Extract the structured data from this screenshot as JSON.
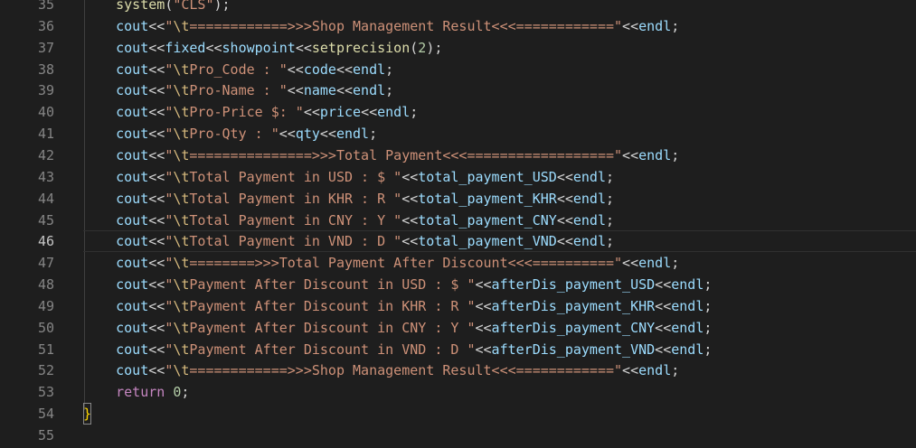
{
  "editor": {
    "colors": {
      "background": "#1e1e1e",
      "line_number": "#858585",
      "line_number_active": "#c6c6c6",
      "function": "#dcdcaa",
      "variable": "#9cdcfe",
      "operator": "#d4d4d4",
      "string": "#ce9178",
      "escape": "#d7ba7d",
      "number": "#b5cea8",
      "keyword": "#c586c0",
      "bracket": "#ffd700"
    },
    "current_line": 46,
    "lines": [
      {
        "number": "35",
        "tokens": [
          {
            "t": "    "
          },
          {
            "t": "system",
            "c": "fn"
          },
          {
            "t": "(",
            "c": "op"
          },
          {
            "t": "\"CLS\"",
            "c": "str"
          },
          {
            "t": ");",
            "c": "op"
          }
        ]
      },
      {
        "number": "36",
        "tokens": [
          {
            "t": "    "
          },
          {
            "t": "cout",
            "c": "var"
          },
          {
            "t": "<<",
            "c": "op"
          },
          {
            "t": "\"",
            "c": "str"
          },
          {
            "t": "\\t",
            "c": "esc"
          },
          {
            "t": "============>>>Shop Management Result<<<============\"",
            "c": "str"
          },
          {
            "t": "<<",
            "c": "op"
          },
          {
            "t": "endl",
            "c": "var"
          },
          {
            "t": ";",
            "c": "op"
          }
        ]
      },
      {
        "number": "37",
        "tokens": [
          {
            "t": "    "
          },
          {
            "t": "cout",
            "c": "var"
          },
          {
            "t": "<<",
            "c": "op"
          },
          {
            "t": "fixed",
            "c": "var"
          },
          {
            "t": "<<",
            "c": "op"
          },
          {
            "t": "showpoint",
            "c": "var"
          },
          {
            "t": "<<",
            "c": "op"
          },
          {
            "t": "setprecision",
            "c": "fn"
          },
          {
            "t": "(",
            "c": "op"
          },
          {
            "t": "2",
            "c": "num"
          },
          {
            "t": ");",
            "c": "op"
          }
        ]
      },
      {
        "number": "38",
        "tokens": [
          {
            "t": "    "
          },
          {
            "t": "cout",
            "c": "var"
          },
          {
            "t": "<<",
            "c": "op"
          },
          {
            "t": "\"",
            "c": "str"
          },
          {
            "t": "\\t",
            "c": "esc"
          },
          {
            "t": "Pro_Code : \"",
            "c": "str"
          },
          {
            "t": "<<",
            "c": "op"
          },
          {
            "t": "code",
            "c": "var"
          },
          {
            "t": "<<",
            "c": "op"
          },
          {
            "t": "endl",
            "c": "var"
          },
          {
            "t": ";",
            "c": "op"
          }
        ]
      },
      {
        "number": "39",
        "tokens": [
          {
            "t": "    "
          },
          {
            "t": "cout",
            "c": "var"
          },
          {
            "t": "<<",
            "c": "op"
          },
          {
            "t": "\"",
            "c": "str"
          },
          {
            "t": "\\t",
            "c": "esc"
          },
          {
            "t": "Pro-Name : \"",
            "c": "str"
          },
          {
            "t": "<<",
            "c": "op"
          },
          {
            "t": "name",
            "c": "var"
          },
          {
            "t": "<<",
            "c": "op"
          },
          {
            "t": "endl",
            "c": "var"
          },
          {
            "t": ";",
            "c": "op"
          }
        ]
      },
      {
        "number": "40",
        "tokens": [
          {
            "t": "    "
          },
          {
            "t": "cout",
            "c": "var"
          },
          {
            "t": "<<",
            "c": "op"
          },
          {
            "t": "\"",
            "c": "str"
          },
          {
            "t": "\\t",
            "c": "esc"
          },
          {
            "t": "Pro-Price $: \"",
            "c": "str"
          },
          {
            "t": "<<",
            "c": "op"
          },
          {
            "t": "price",
            "c": "var"
          },
          {
            "t": "<<",
            "c": "op"
          },
          {
            "t": "endl",
            "c": "var"
          },
          {
            "t": ";",
            "c": "op"
          }
        ]
      },
      {
        "number": "41",
        "tokens": [
          {
            "t": "    "
          },
          {
            "t": "cout",
            "c": "var"
          },
          {
            "t": "<<",
            "c": "op"
          },
          {
            "t": "\"",
            "c": "str"
          },
          {
            "t": "\\t",
            "c": "esc"
          },
          {
            "t": "Pro-Qty : \"",
            "c": "str"
          },
          {
            "t": "<<",
            "c": "op"
          },
          {
            "t": "qty",
            "c": "var"
          },
          {
            "t": "<<",
            "c": "op"
          },
          {
            "t": "endl",
            "c": "var"
          },
          {
            "t": ";",
            "c": "op"
          }
        ]
      },
      {
        "number": "42",
        "tokens": [
          {
            "t": "    "
          },
          {
            "t": "cout",
            "c": "var"
          },
          {
            "t": "<<",
            "c": "op"
          },
          {
            "t": "\"",
            "c": "str"
          },
          {
            "t": "\\t",
            "c": "esc"
          },
          {
            "t": "===============>>>Total Payment<<<==================\"",
            "c": "str"
          },
          {
            "t": "<<",
            "c": "op"
          },
          {
            "t": "endl",
            "c": "var"
          },
          {
            "t": ";",
            "c": "op"
          }
        ]
      },
      {
        "number": "43",
        "tokens": [
          {
            "t": "    "
          },
          {
            "t": "cout",
            "c": "var"
          },
          {
            "t": "<<",
            "c": "op"
          },
          {
            "t": "\"",
            "c": "str"
          },
          {
            "t": "\\t",
            "c": "esc"
          },
          {
            "t": "Total Payment in USD : $ \"",
            "c": "str"
          },
          {
            "t": "<<",
            "c": "op"
          },
          {
            "t": "total_payment_USD",
            "c": "var"
          },
          {
            "t": "<<",
            "c": "op"
          },
          {
            "t": "endl",
            "c": "var"
          },
          {
            "t": ";",
            "c": "op"
          }
        ]
      },
      {
        "number": "44",
        "tokens": [
          {
            "t": "    "
          },
          {
            "t": "cout",
            "c": "var"
          },
          {
            "t": "<<",
            "c": "op"
          },
          {
            "t": "\"",
            "c": "str"
          },
          {
            "t": "\\t",
            "c": "esc"
          },
          {
            "t": "Total Payment in KHR : R \"",
            "c": "str"
          },
          {
            "t": "<<",
            "c": "op"
          },
          {
            "t": "total_payment_KHR",
            "c": "var"
          },
          {
            "t": "<<",
            "c": "op"
          },
          {
            "t": "endl",
            "c": "var"
          },
          {
            "t": ";",
            "c": "op"
          }
        ]
      },
      {
        "number": "45",
        "tokens": [
          {
            "t": "    "
          },
          {
            "t": "cout",
            "c": "var"
          },
          {
            "t": "<<",
            "c": "op"
          },
          {
            "t": "\"",
            "c": "str"
          },
          {
            "t": "\\t",
            "c": "esc"
          },
          {
            "t": "Total Payment in CNY : Y \"",
            "c": "str"
          },
          {
            "t": "<<",
            "c": "op"
          },
          {
            "t": "total_payment_CNY",
            "c": "var"
          },
          {
            "t": "<<",
            "c": "op"
          },
          {
            "t": "endl",
            "c": "var"
          },
          {
            "t": ";",
            "c": "op"
          }
        ]
      },
      {
        "number": "46",
        "tokens": [
          {
            "t": "    "
          },
          {
            "t": "cout",
            "c": "var"
          },
          {
            "t": "<<",
            "c": "op"
          },
          {
            "t": "\"",
            "c": "str"
          },
          {
            "t": "\\t",
            "c": "esc"
          },
          {
            "t": "Total Payment in VND : D \"",
            "c": "str"
          },
          {
            "t": "<<",
            "c": "op"
          },
          {
            "t": "total_payment_VND",
            "c": "var"
          },
          {
            "t": "<<",
            "c": "op"
          },
          {
            "t": "endl",
            "c": "var"
          },
          {
            "t": ";",
            "c": "op"
          }
        ]
      },
      {
        "number": "47",
        "tokens": [
          {
            "t": "    "
          },
          {
            "t": "cout",
            "c": "var"
          },
          {
            "t": "<<",
            "c": "op"
          },
          {
            "t": "\"",
            "c": "str"
          },
          {
            "t": "\\t",
            "c": "esc"
          },
          {
            "t": "========>>>Total Payment After Discount<<<==========\"",
            "c": "str"
          },
          {
            "t": "<<",
            "c": "op"
          },
          {
            "t": "endl",
            "c": "var"
          },
          {
            "t": ";",
            "c": "op"
          }
        ]
      },
      {
        "number": "48",
        "tokens": [
          {
            "t": "    "
          },
          {
            "t": "cout",
            "c": "var"
          },
          {
            "t": "<<",
            "c": "op"
          },
          {
            "t": "\"",
            "c": "str"
          },
          {
            "t": "\\t",
            "c": "esc"
          },
          {
            "t": "Payment After Discount in USD : $ \"",
            "c": "str"
          },
          {
            "t": "<<",
            "c": "op"
          },
          {
            "t": "afterDis_payment_USD",
            "c": "var"
          },
          {
            "t": "<<",
            "c": "op"
          },
          {
            "t": "endl",
            "c": "var"
          },
          {
            "t": ";",
            "c": "op"
          }
        ]
      },
      {
        "number": "49",
        "tokens": [
          {
            "t": "    "
          },
          {
            "t": "cout",
            "c": "var"
          },
          {
            "t": "<<",
            "c": "op"
          },
          {
            "t": "\"",
            "c": "str"
          },
          {
            "t": "\\t",
            "c": "esc"
          },
          {
            "t": "Payment After Discount in KHR : R \"",
            "c": "str"
          },
          {
            "t": "<<",
            "c": "op"
          },
          {
            "t": "afterDis_payment_KHR",
            "c": "var"
          },
          {
            "t": "<<",
            "c": "op"
          },
          {
            "t": "endl",
            "c": "var"
          },
          {
            "t": ";",
            "c": "op"
          }
        ]
      },
      {
        "number": "50",
        "tokens": [
          {
            "t": "    "
          },
          {
            "t": "cout",
            "c": "var"
          },
          {
            "t": "<<",
            "c": "op"
          },
          {
            "t": "\"",
            "c": "str"
          },
          {
            "t": "\\t",
            "c": "esc"
          },
          {
            "t": "Payment After Discount in CNY : Y \"",
            "c": "str"
          },
          {
            "t": "<<",
            "c": "op"
          },
          {
            "t": "afterDis_payment_CNY",
            "c": "var"
          },
          {
            "t": "<<",
            "c": "op"
          },
          {
            "t": "endl",
            "c": "var"
          },
          {
            "t": ";",
            "c": "op"
          }
        ]
      },
      {
        "number": "51",
        "tokens": [
          {
            "t": "    "
          },
          {
            "t": "cout",
            "c": "var"
          },
          {
            "t": "<<",
            "c": "op"
          },
          {
            "t": "\"",
            "c": "str"
          },
          {
            "t": "\\t",
            "c": "esc"
          },
          {
            "t": "Payment After Discount in VND : D \"",
            "c": "str"
          },
          {
            "t": "<<",
            "c": "op"
          },
          {
            "t": "afterDis_payment_VND",
            "c": "var"
          },
          {
            "t": "<<",
            "c": "op"
          },
          {
            "t": "endl",
            "c": "var"
          },
          {
            "t": ";",
            "c": "op"
          }
        ]
      },
      {
        "number": "52",
        "tokens": [
          {
            "t": "    "
          },
          {
            "t": "cout",
            "c": "var"
          },
          {
            "t": "<<",
            "c": "op"
          },
          {
            "t": "\"",
            "c": "str"
          },
          {
            "t": "\\t",
            "c": "esc"
          },
          {
            "t": "============>>>Shop Management Result<<<============\"",
            "c": "str"
          },
          {
            "t": "<<",
            "c": "op"
          },
          {
            "t": "endl",
            "c": "var"
          },
          {
            "t": ";",
            "c": "op"
          }
        ]
      },
      {
        "number": "53",
        "tokens": [
          {
            "t": "    "
          },
          {
            "t": "return",
            "c": "kw"
          },
          {
            "t": " "
          },
          {
            "t": "0",
            "c": "num"
          },
          {
            "t": ";",
            "c": "op"
          }
        ]
      },
      {
        "number": "54",
        "tokens": [
          {
            "t": "}",
            "c": "brace"
          }
        ]
      },
      {
        "number": "55",
        "tokens": []
      }
    ]
  }
}
